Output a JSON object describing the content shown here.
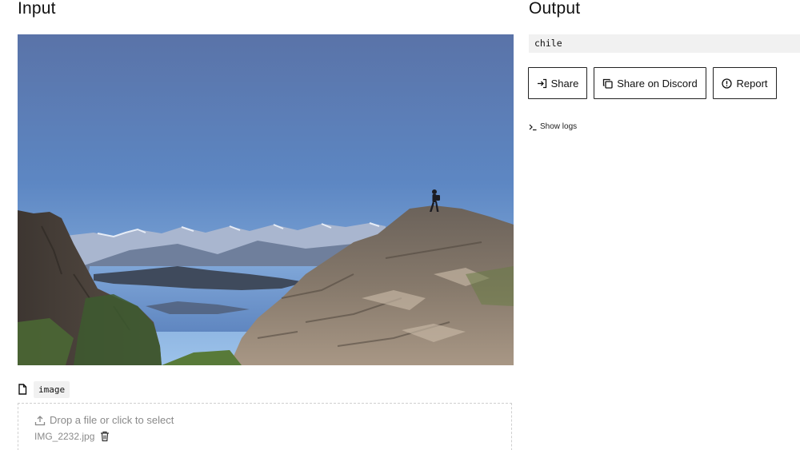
{
  "input": {
    "heading": "Input",
    "image_alt": "hiker-on-rocky-peak-overlooking-lake-and-mountains",
    "field": {
      "name": "image",
      "dropzone_text": "Drop a file or click to select",
      "file_name": "IMG_2232.jpg"
    }
  },
  "output": {
    "heading": "Output",
    "value": "chile",
    "buttons": {
      "share": "Share",
      "share_discord": "Share on Discord",
      "report": "Report"
    },
    "show_logs": "Show logs"
  },
  "icons": {
    "file": "file-icon",
    "upload": "upload-icon",
    "trash": "trash-icon",
    "share": "share-arrow-icon",
    "copy": "copy-icon",
    "report": "alert-circle-icon",
    "terminal": "terminal-icon"
  }
}
